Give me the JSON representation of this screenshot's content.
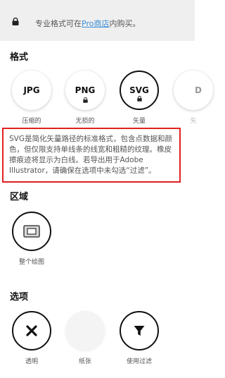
{
  "banner": {
    "text_before": "专业格式可在",
    "link": "Pro商店",
    "text_after": "内购买。"
  },
  "format": {
    "title": "格式",
    "items": [
      {
        "label": "JPG",
        "caption": "压缩的",
        "locked": false,
        "selected": false
      },
      {
        "label": "PNG",
        "caption": "无损的",
        "locked": true,
        "selected": false
      },
      {
        "label": "SVG",
        "caption": "矢量",
        "locked": true,
        "selected": true
      },
      {
        "label": "D",
        "caption": "矢",
        "locked": false,
        "selected": false
      }
    ]
  },
  "info": {
    "text": "SVG是简化矢量路径的标准格式，包含点数据和颜色，但仅限支持单线条的线宽和粗糙的纹理。橡皮擦痕迹将显示为白线。若导出用于Adobe Illustrator，请确保在选项中未勾选“过滤”。"
  },
  "area": {
    "title": "区域",
    "items": [
      {
        "caption": "整个绘图",
        "icon": "canvas-icon"
      }
    ]
  },
  "options": {
    "title": "选项",
    "items": [
      {
        "caption": "透明",
        "icon": "close-icon"
      },
      {
        "caption": "纸张",
        "icon": "paper-icon"
      },
      {
        "caption": "使用过滤",
        "icon": "filter-icon"
      }
    ]
  }
}
